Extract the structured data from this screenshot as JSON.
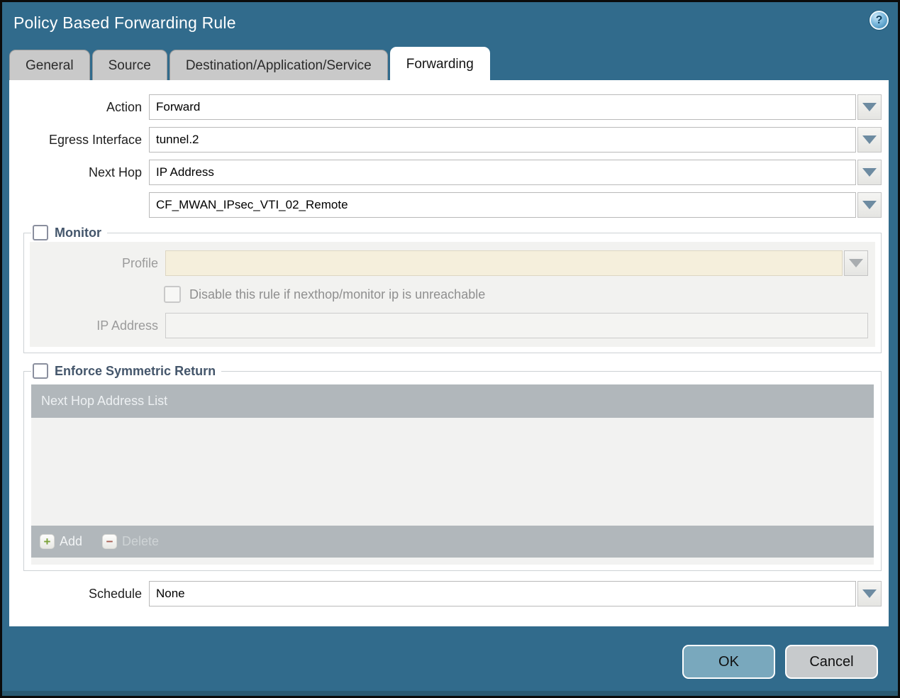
{
  "window": {
    "title": "Policy Based Forwarding Rule",
    "help_glyph": "?"
  },
  "tabs": [
    {
      "label": "General",
      "active": false
    },
    {
      "label": "Source",
      "active": false
    },
    {
      "label": "Destination/Application/Service",
      "active": false
    },
    {
      "label": "Forwarding",
      "active": true
    }
  ],
  "form": {
    "action": {
      "label": "Action",
      "value": "Forward"
    },
    "egress_interface": {
      "label": "Egress Interface",
      "value": "tunnel.2"
    },
    "next_hop": {
      "label": "Next Hop",
      "value": "IP Address"
    },
    "next_hop_address": {
      "value": "CF_MWAN_IPsec_VTI_02_Remote"
    },
    "monitor": {
      "legend": "Monitor",
      "checked": false,
      "profile": {
        "label": "Profile",
        "value": ""
      },
      "disable_rule": {
        "label": "Disable this rule if nexthop/monitor ip is unreachable",
        "checked": false
      },
      "ip_address": {
        "label": "IP Address",
        "value": ""
      }
    },
    "enforce_symmetric_return": {
      "legend": "Enforce Symmetric Return",
      "checked": false,
      "list_header": "Next Hop Address List",
      "rows": [],
      "add_label": "Add",
      "add_icon": "+",
      "delete_label": "Delete",
      "delete_icon": "−"
    },
    "schedule": {
      "label": "Schedule",
      "value": "None"
    }
  },
  "footer": {
    "ok_label": "OK",
    "cancel_label": "Cancel"
  },
  "colors": {
    "window_bg": "#316b8c",
    "active_tab_bg": "#ffffff",
    "inactive_tab_bg": "#c9c9c9",
    "section_title": "#44566b",
    "disabled_field_bg": "#f5efdc",
    "table_bar_bg": "#b1b7bb",
    "ok_button_bg": "#79a8bd",
    "cancel_button_bg": "#c7cacc",
    "dropdown_arrow": "#6d8ba1"
  }
}
